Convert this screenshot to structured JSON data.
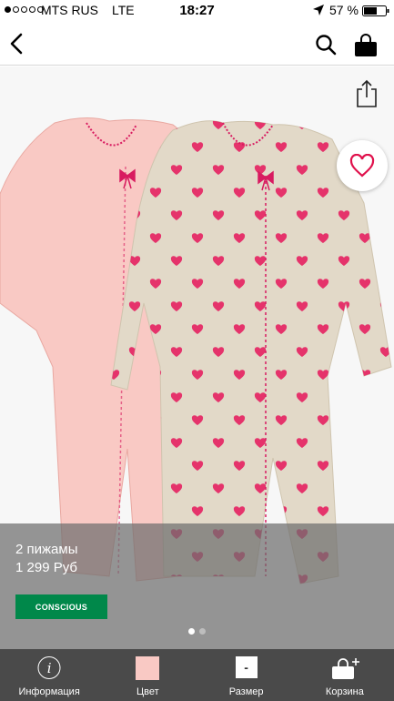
{
  "status_bar": {
    "carrier": "MTS RUS",
    "network": "LTE",
    "time": "18:27",
    "battery": "57 %"
  },
  "nav": {
    "icons": [
      "back-icon",
      "search-icon",
      "shopping-bag-icon"
    ]
  },
  "product": {
    "name": "2 пижамы",
    "price": "1 299 Руб",
    "badge": "CONSCIOUS",
    "gallery": {
      "pages": 2,
      "current": 1
    },
    "colors": {
      "left_romper": "#f9c9c4",
      "right_romper": "#e2d9c8",
      "hearts": "#e5336b",
      "trim": "#d81b60"
    }
  },
  "tabs": [
    {
      "label": "Информация",
      "icon": "info-icon"
    },
    {
      "label": "Цвет",
      "icon": "color-swatch"
    },
    {
      "label": "Размер",
      "icon": "size-box",
      "value": "-"
    },
    {
      "label": "Корзина",
      "icon": "cart-add-icon"
    }
  ]
}
